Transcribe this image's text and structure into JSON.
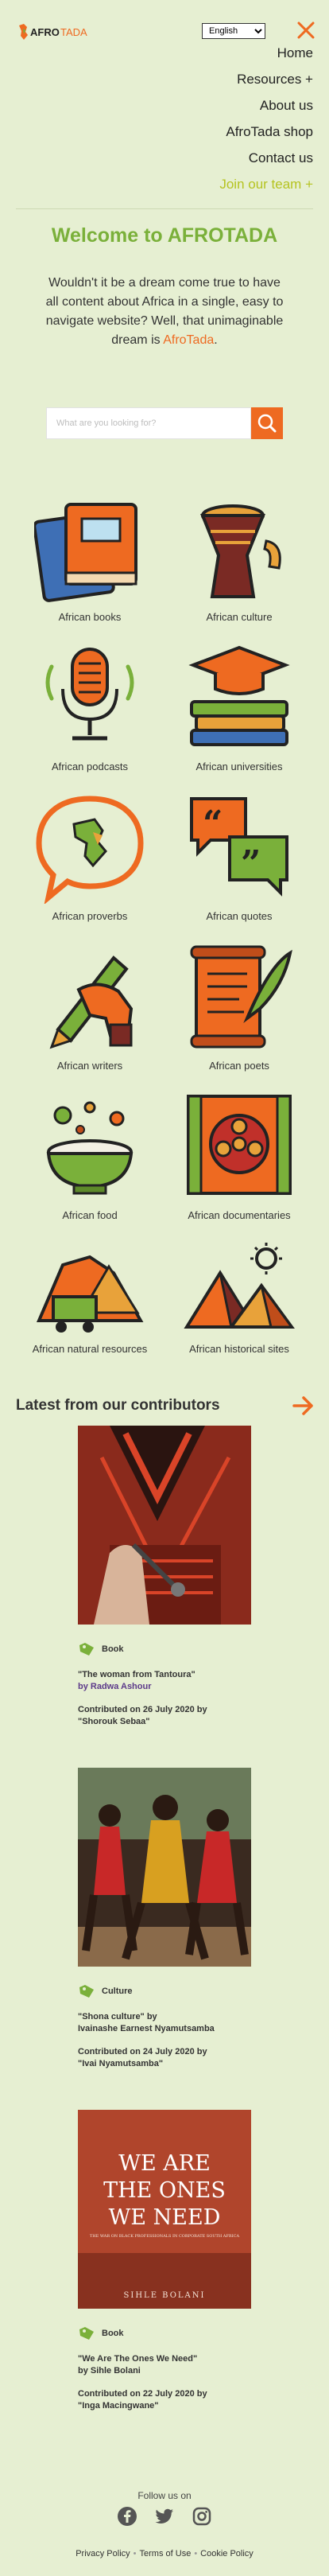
{
  "header": {
    "logo_text": "AFRO TADA",
    "language": "English",
    "language_options": [
      "English"
    ],
    "accent_color": "#ee6a21"
  },
  "nav": {
    "items": [
      {
        "label": "Home"
      },
      {
        "label": "Resources +"
      },
      {
        "label": "About us"
      },
      {
        "label": "AfroTada shop"
      },
      {
        "label": "Contact us"
      },
      {
        "label": "Join our team +"
      }
    ]
  },
  "welcome": {
    "title": "Welcome to AFROTADA",
    "text": "Wouldn't it be a dream come true to have all content about Africa in a single, easy to navigate website? Well, that unimaginable dream is ",
    "highlight": "AfroTada",
    "end": "."
  },
  "search": {
    "placeholder": "What are you looking for?",
    "icon": "search-icon"
  },
  "categories": [
    {
      "label": "African books",
      "icon": "books-icon"
    },
    {
      "label": "African culture",
      "icon": "drum-icon"
    },
    {
      "label": "African podcasts",
      "icon": "microphone-icon"
    },
    {
      "label": "African universities",
      "icon": "graduation-cap-icon"
    },
    {
      "label": "African proverbs",
      "icon": "speech-bubble-africa-icon"
    },
    {
      "label": "African quotes",
      "icon": "quotes-icon"
    },
    {
      "label": "African writers",
      "icon": "pen-hand-icon"
    },
    {
      "label": "African poets",
      "icon": "scroll-quill-icon"
    },
    {
      "label": "African food",
      "icon": "food-bowl-icon"
    },
    {
      "label": "African documentaries",
      "icon": "film-reel-icon"
    },
    {
      "label": "African natural resources",
      "icon": "mining-icon"
    },
    {
      "label": "African historical sites",
      "icon": "pyramids-icon"
    }
  ],
  "latest": {
    "title": "Latest from our contributors",
    "posts": [
      {
        "tag": "Book",
        "title": "\"The woman from Tantoura\"",
        "author": "by Radwa Ashour",
        "contributed": "Contributed on 26 July 2020 by",
        "contributor": "\"Shorouk Sebaa\""
      },
      {
        "tag": "Culture",
        "title": "\"Shona culture\" by",
        "author": "Ivainashe Earnest Nyamutsamba",
        "contributed": "Contributed on 24 July 2020 by",
        "contributor": "\"Ivai Nyamutsamba\""
      },
      {
        "tag": "Book",
        "title": "\"We Are The Ones We Need\"",
        "author": "by Sihle Bolani",
        "contributed": "Contributed on 22 July 2020 by",
        "contributor": "\"Inga Macingwane\"",
        "cover": {
          "line1": "WE ARE",
          "line2": "THE ONES",
          "line3": "WE NEED",
          "subtitle": "THE WAR ON BLACK PROFESSIONALS IN CORPORATE SOUTH AFRICA",
          "author": "SIHLE BOLANI"
        }
      }
    ]
  },
  "footer": {
    "follow": "Follow us on",
    "links": [
      "Privacy Policy",
      "Terms of Use",
      "Cookie Policy"
    ],
    "separator": "•"
  }
}
